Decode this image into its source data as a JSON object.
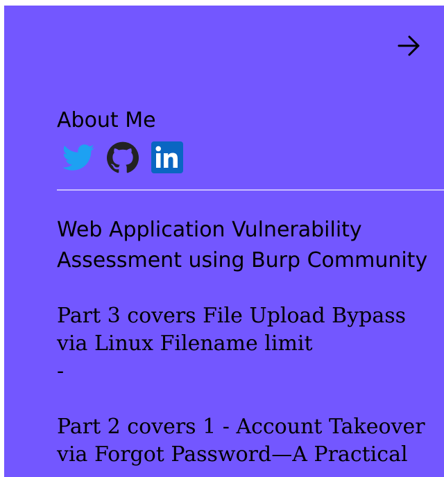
{
  "about": {
    "title": "About Me"
  },
  "social": {
    "links": [
      {
        "name": "twitter-icon",
        "color": "#1da1f2"
      },
      {
        "name": "github-icon",
        "color": "#222222"
      },
      {
        "name": "linkedin-icon",
        "color": "#0a66c2"
      }
    ]
  },
  "post": {
    "heading": "Web Application Vulnerability Assessment using Burp Community",
    "part3": "Part 3 covers File Upload Bypass via Linux Filename limit",
    "separator": "-",
    "part2": "Part 2 covers 1 - Account Takeover via Forgot Password—A Practical"
  },
  "colors": {
    "panel_background": "#7357ff",
    "divider": "#c8bcff"
  }
}
